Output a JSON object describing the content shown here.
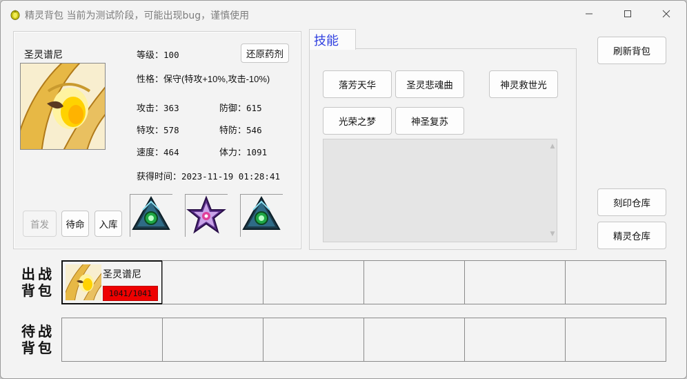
{
  "window": {
    "title": "精灵背包 当前为测试阶段，可能出现bug，谨慎使用"
  },
  "pet": {
    "name": "圣灵谱尼",
    "level_label": "等级：",
    "level": "100",
    "nature_label": "性格：",
    "nature": "保守(特攻+10%,攻击-10%)",
    "attack_label": "攻击：",
    "attack": "363",
    "defense_label": "防御：",
    "defense": "615",
    "sp_attack_label": "特攻：",
    "sp_attack": "578",
    "sp_defense_label": "特防：",
    "sp_defense": "546",
    "speed_label": "速度：",
    "speed": "464",
    "hp_label": "体力：",
    "hp": "1091",
    "obtained_label": "获得时间：",
    "obtained": "2023-11-19 01:28:41"
  },
  "buttons": {
    "restore_potion": "还原药剂",
    "first": "首发",
    "standby": "待命",
    "store": "入库",
    "refresh_bag": "刷新背包",
    "imprint_storage": "刻印仓库",
    "pet_storage": "精灵仓库"
  },
  "skills": {
    "tab_label": "技能",
    "items": [
      "落芳天华",
      "圣灵悲魂曲",
      "神灵救世光",
      "光荣之梦",
      "神圣复苏"
    ]
  },
  "battle_bag": {
    "label_line1": "出战",
    "label_line2": "背包",
    "slots": [
      {
        "name": "圣灵谱尼",
        "hp": "1041/1041"
      }
    ]
  },
  "standby_bag": {
    "label_line1": "待战",
    "label_line2": "背包"
  },
  "colors": {
    "accent_tab": "#2f3fe0",
    "hp_bar": "#ee0000",
    "window_bg": "#f3f3f3"
  }
}
